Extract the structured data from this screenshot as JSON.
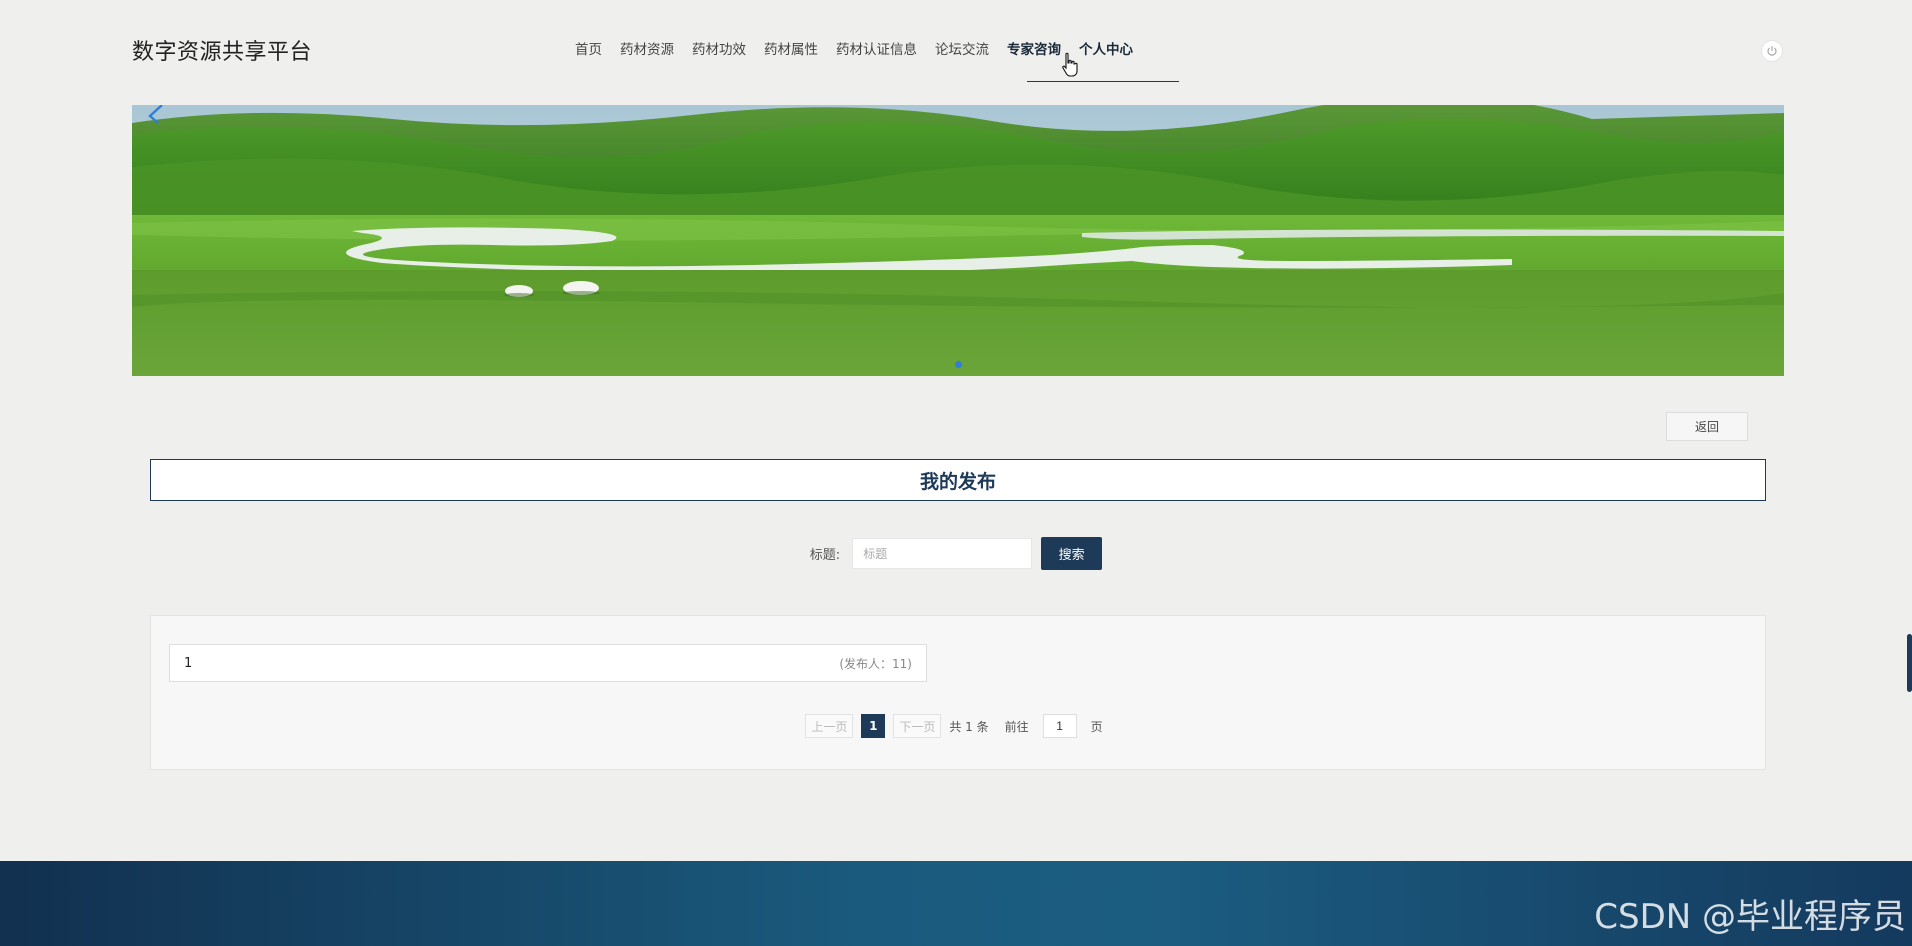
{
  "header": {
    "brand": "数字资源共享平台",
    "nav": [
      {
        "label": "首页"
      },
      {
        "label": "药材资源"
      },
      {
        "label": "药材功效"
      },
      {
        "label": "药材属性"
      },
      {
        "label": "药材认证信息"
      },
      {
        "label": "论坛交流"
      },
      {
        "label": "专家咨询"
      },
      {
        "label": "个人中心"
      }
    ],
    "power_icon": "power-icon"
  },
  "banner": {
    "slide_count": 1,
    "active_slide": 1
  },
  "page": {
    "back_label": "返回",
    "section_title": "我的发布"
  },
  "search": {
    "label": "标题:",
    "placeholder": "标题",
    "value": "",
    "button_label": "搜索"
  },
  "list": {
    "items": [
      {
        "title": "1",
        "meta": "(发布人：11)"
      }
    ]
  },
  "pager": {
    "prev_label": "上一页",
    "current_page": "1",
    "next_label": "下一页",
    "total_text": "共 1 条",
    "goto_label": "前往",
    "goto_value": "1",
    "page_unit": "页"
  },
  "footer": {
    "watermark": "CSDN @毕业程序员"
  },
  "colors": {
    "accent": "#1d3a58",
    "background": "#efefee",
    "pager_dot": "#2f7fd6"
  }
}
